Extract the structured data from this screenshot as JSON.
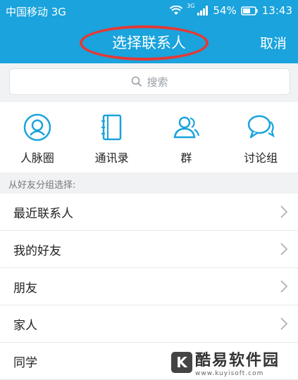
{
  "status_bar": {
    "carrier": "中国移动 3G",
    "network_small": "3G",
    "battery": "54%",
    "time": "13:43"
  },
  "header": {
    "title": "选择联系人",
    "cancel_label": "取消"
  },
  "search": {
    "placeholder": "搜索"
  },
  "quick_entries": [
    {
      "label": "人脉圈",
      "icon": "person-circle-icon"
    },
    {
      "label": "通讯录",
      "icon": "address-book-icon"
    },
    {
      "label": "群",
      "icon": "group-icon"
    },
    {
      "label": "讨论组",
      "icon": "chat-bubbles-icon"
    }
  ],
  "section": {
    "title": "从好友分组选择:"
  },
  "groups": [
    {
      "name": "最近联系人"
    },
    {
      "name": "我的好友"
    },
    {
      "name": "朋友"
    },
    {
      "name": "家人"
    },
    {
      "name": "同学"
    }
  ],
  "watermark": {
    "text": "酷易软件园",
    "url": "www.kuyisoft.com",
    "badge": "K"
  },
  "colors": {
    "brand": "#1aa3dc",
    "annotation": "#e53935"
  }
}
